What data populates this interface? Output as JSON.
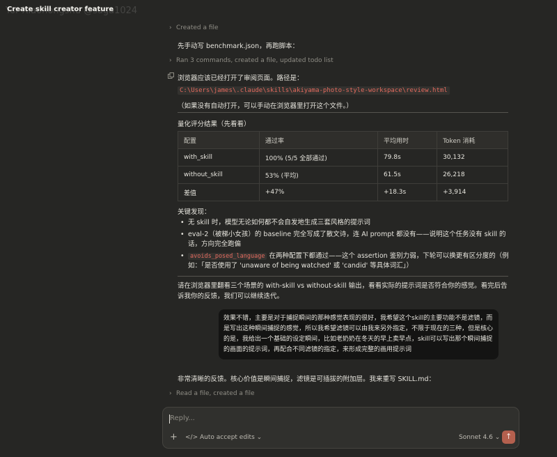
{
  "window": {
    "title": "Create skill creator feature",
    "watermark": "Yor Xiaohongshu @saga1024"
  },
  "steps": {
    "created_file": "Created a file",
    "ran_commands": "Ran 3 commands, created a file, updated todo list",
    "read_file": "Read a file, created a file"
  },
  "messages": {
    "intro": "先手动写 benchmark.json，再跑脚本：",
    "browser_line": "浏览器应该已经打开了审阅页面。路径是：",
    "path": "C:\\Users\\james\\.claude\\skills\\akiyama-photo-style-workspace\\review.html",
    "manual_open": "（如果没有自动打开，可以手动在浏览器里打开这个文件。）",
    "quant_heading": "量化评分结果（先看看）",
    "findings_heading": "关键发现：",
    "findings": [
      "无 skill 时，模型无论如何都不会自发地生成三套风格的提示词",
      "eval-2（被梯小女孩）的 baseline 完全写成了散文诗，连 AI prompt 都没有——说明这个任务没有 skill 的话，方向完全跑偏",
      "在两种配置下都通过——这个 assertion 鉴别力弱，下轮可以换更有区分度的（例如：「是否使用了 'unaware of being watched' 或 'candid' 等具体词汇」）"
    ],
    "finding_tag": "avoids_posed_language",
    "review_prompt": "请在浏览器里翻看三个场景的 with-skill vs without-skill 输出，看看实际的提示词是否符合你的感觉。看完后告诉我你的反馈，我们可以继续迭代。",
    "user_feedback": "效果不错，主要是对于捕捉瞬间的那种感觉表现的很好，我希望这个skill的主要功能不是滤镜，而是写出这种瞬间捕捉的感觉，所以我希望滤镜可以由我来另外指定，不限于现在的三种，但是核心的是，我给出一个基础的设定瞬间，比如老奶奶在冬天的早上卖早点，skill可以写出那个瞬间捕捉的画面的提示词，再配合不同滤镜的指定，来形成完整的画用提示词",
    "response": "非常清晰的反馈。核心价值是瞬间捕捉，滤镜是可插拔的附加层。我来重写 SKILL.md："
  },
  "table": {
    "headers": [
      "配置",
      "通过率",
      "平均用时",
      "Token 消耗"
    ],
    "rows": [
      [
        "with_skill",
        "100% (5/5 全部通过)",
        "79.8s",
        "30,132"
      ],
      [
        "without_skill",
        "53% (平均)",
        "61.5s",
        "26,218"
      ],
      [
        "差值",
        "+47%",
        "+18.3s",
        "+3,914"
      ]
    ]
  },
  "composer": {
    "placeholder": "Reply...",
    "auto_accept": "Auto accept edits",
    "model": "Sonnet 4.6"
  },
  "icons": {
    "chevron": "chevron-right-icon",
    "copy": "copy-icon",
    "plus": "plus-icon",
    "code": "code-icon",
    "dropdown": "chevron-down-icon",
    "send": "send-icon"
  },
  "colors": {
    "background": "#262624",
    "code_text": "#e26a5e",
    "send_button": "#b4604e"
  }
}
